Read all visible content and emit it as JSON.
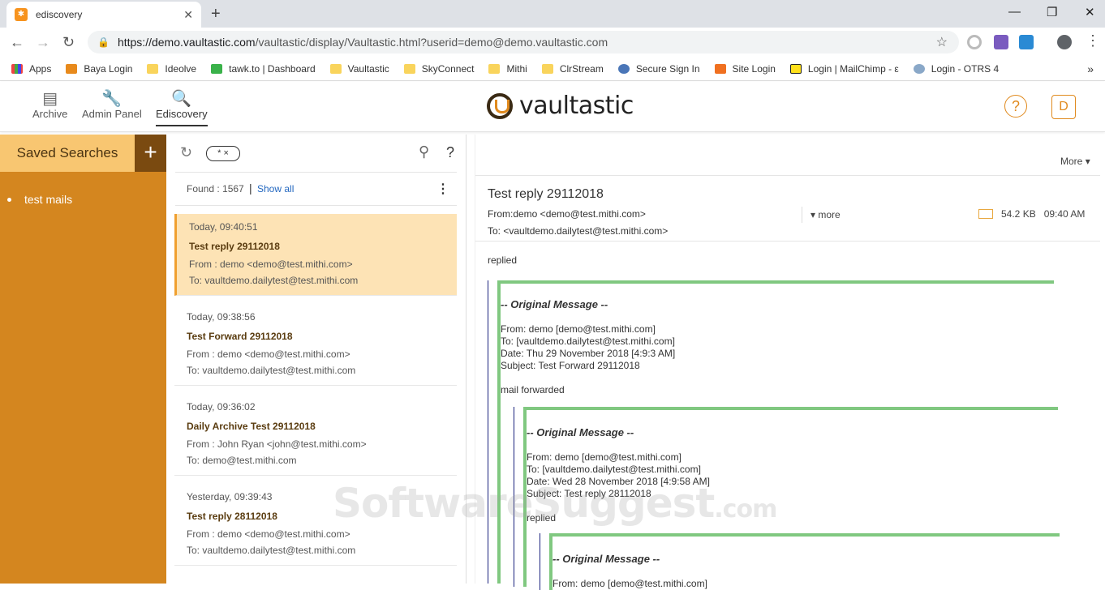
{
  "browser": {
    "tab_title": "ediscovery",
    "url_host": "https://demo.vaultastic.com",
    "url_path": "/vaultastic/display/Vaultastic.html?userid=demo@demo.vaultastic.com",
    "bookmarks": [
      "Apps",
      "Baya Login",
      "Ideolve",
      "tawk.to | Dashboard",
      "Vaultastic",
      "SkyConnect",
      "Mithi",
      "ClrStream",
      "Secure Sign In",
      "Site Login",
      "Login | MailChimp - ε",
      "Login - OTRS 4"
    ]
  },
  "nav": {
    "items": [
      "Archive",
      "Admin Panel",
      "Ediscovery"
    ],
    "logo": "vaultastic",
    "user_initial": "D",
    "help": "?"
  },
  "sidebar": {
    "title": "Saved Searches",
    "add": "+",
    "items": [
      "test mails"
    ]
  },
  "list": {
    "chip": "* ×",
    "help": "?",
    "found": "Found : 1567",
    "sep": "|",
    "show_all": "Show all",
    "messages": [
      {
        "date": "Today, 09:40:51",
        "subject": "Test reply 29112018",
        "from": "From : demo <demo@test.mithi.com>",
        "to": "To: vaultdemo.dailytest@test.mithi.com"
      },
      {
        "date": "Today, 09:38:56",
        "subject": "Test Forward 29112018",
        "from": "From : demo <demo@test.mithi.com>",
        "to": "To: vaultdemo.dailytest@test.mithi.com"
      },
      {
        "date": "Today, 09:36:02",
        "subject": "Daily Archive Test 29112018",
        "from": "From : John Ryan <john@test.mithi.com>",
        "to": "To: demo@test.mithi.com"
      },
      {
        "date": "Yesterday, 09:39:43",
        "subject": "Test reply 28112018",
        "from": "From : demo <demo@test.mithi.com>",
        "to": "To: vaultdemo.dailytest@test.mithi.com"
      }
    ]
  },
  "reader": {
    "more_top": "More",
    "subject": "Test reply 29112018",
    "from": "From:demo <demo@test.mithi.com>",
    "to": "To: <vaultdemo.dailytest@test.mithi.com>",
    "more": "more",
    "size": "54.2 KB",
    "time": "09:40 AM",
    "body": "replied",
    "quote1": {
      "title": "-- Original Message --",
      "from": "From: demo [demo@test.mithi.com]",
      "to": "To: [vaultdemo.dailytest@test.mithi.com]",
      "date": "Date: Thu 29 November 2018 [4:9:3 AM]",
      "subject": "Subject: Test Forward 29112018",
      "body": "mail forwarded"
    },
    "quote2": {
      "title": "-- Original Message --",
      "from": "From: demo [demo@test.mithi.com]",
      "to": "To: [vaultdemo.dailytest@test.mithi.com]",
      "date": "Date: Wed 28 November 2018 [4:9:58 AM]",
      "subject": "Subject: Test reply 28112018",
      "body": "replied"
    },
    "quote3": {
      "title": "-- Original Message --",
      "from": "From: demo [demo@test.mithi.com]"
    }
  },
  "watermark": {
    "main": "SoftwareSuggest",
    "suffix": ".com"
  }
}
